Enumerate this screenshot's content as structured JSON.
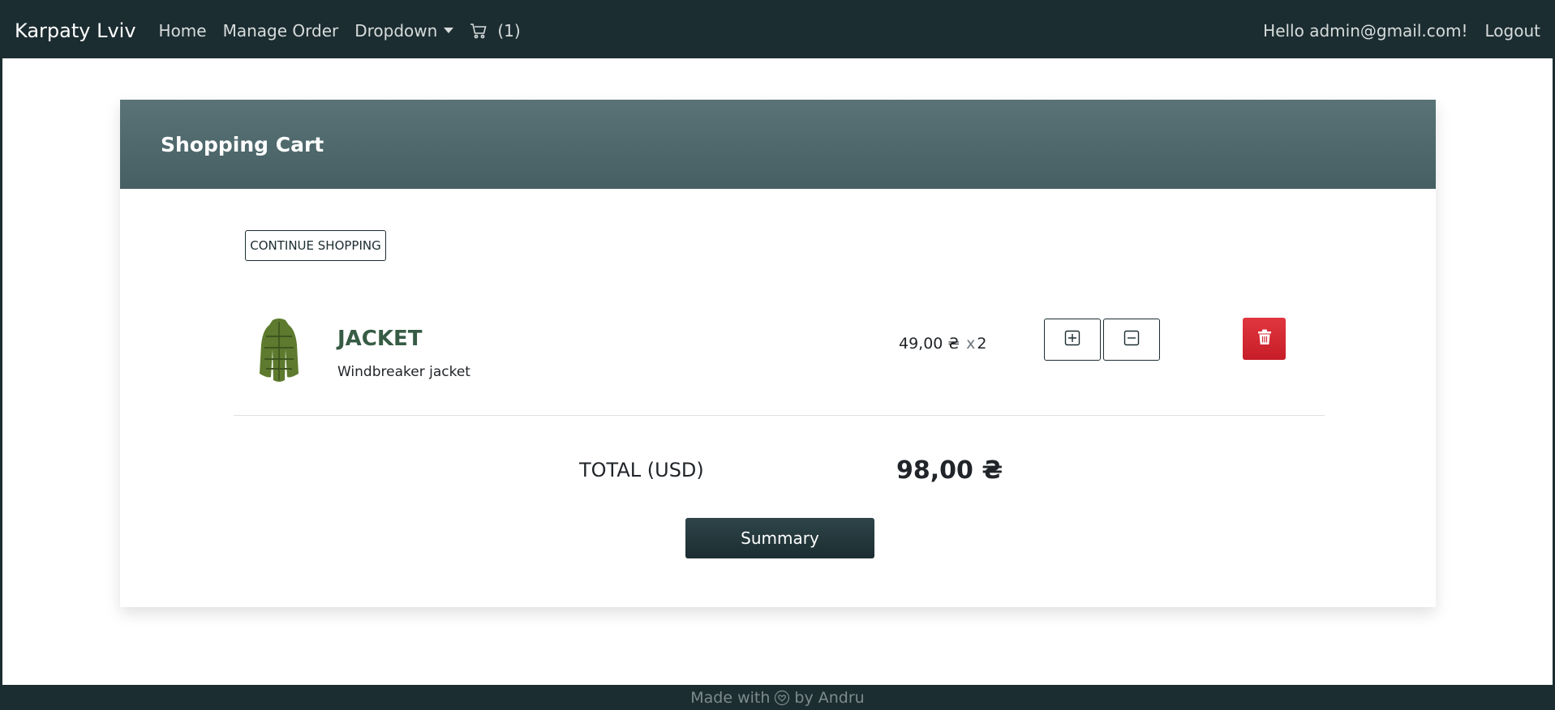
{
  "navbar": {
    "brand": "Karpaty Lviv",
    "links": {
      "home": "Home",
      "manage_order": "Manage Order",
      "dropdown": "Dropdown"
    },
    "cart_count": "(1)",
    "greeting": "Hello admin@gmail.com!",
    "logout": "Logout"
  },
  "cart": {
    "title": "Shopping Cart",
    "continue_label": "CONTINUE SHOPPING",
    "items": [
      {
        "name": "JACKET",
        "description": "Windbreaker jacket",
        "price": "49,00 ₴",
        "times": "x",
        "quantity": "2"
      }
    ],
    "total_label": "TOTAL (USD)",
    "total_value": "98,00 ₴",
    "summary_label": "Summary"
  },
  "footer": {
    "made_with": "Made with",
    "by": "by Andru"
  },
  "colors": {
    "nav_bg": "#1c2d31",
    "header_bg": "#4f686c",
    "product_name": "#375c45",
    "danger": "#dc3545"
  },
  "icons": {
    "cart": "cart-icon",
    "plus": "plus-square-icon",
    "minus": "minus-square-icon",
    "trash": "trash-icon",
    "heart": "heart-icon"
  }
}
